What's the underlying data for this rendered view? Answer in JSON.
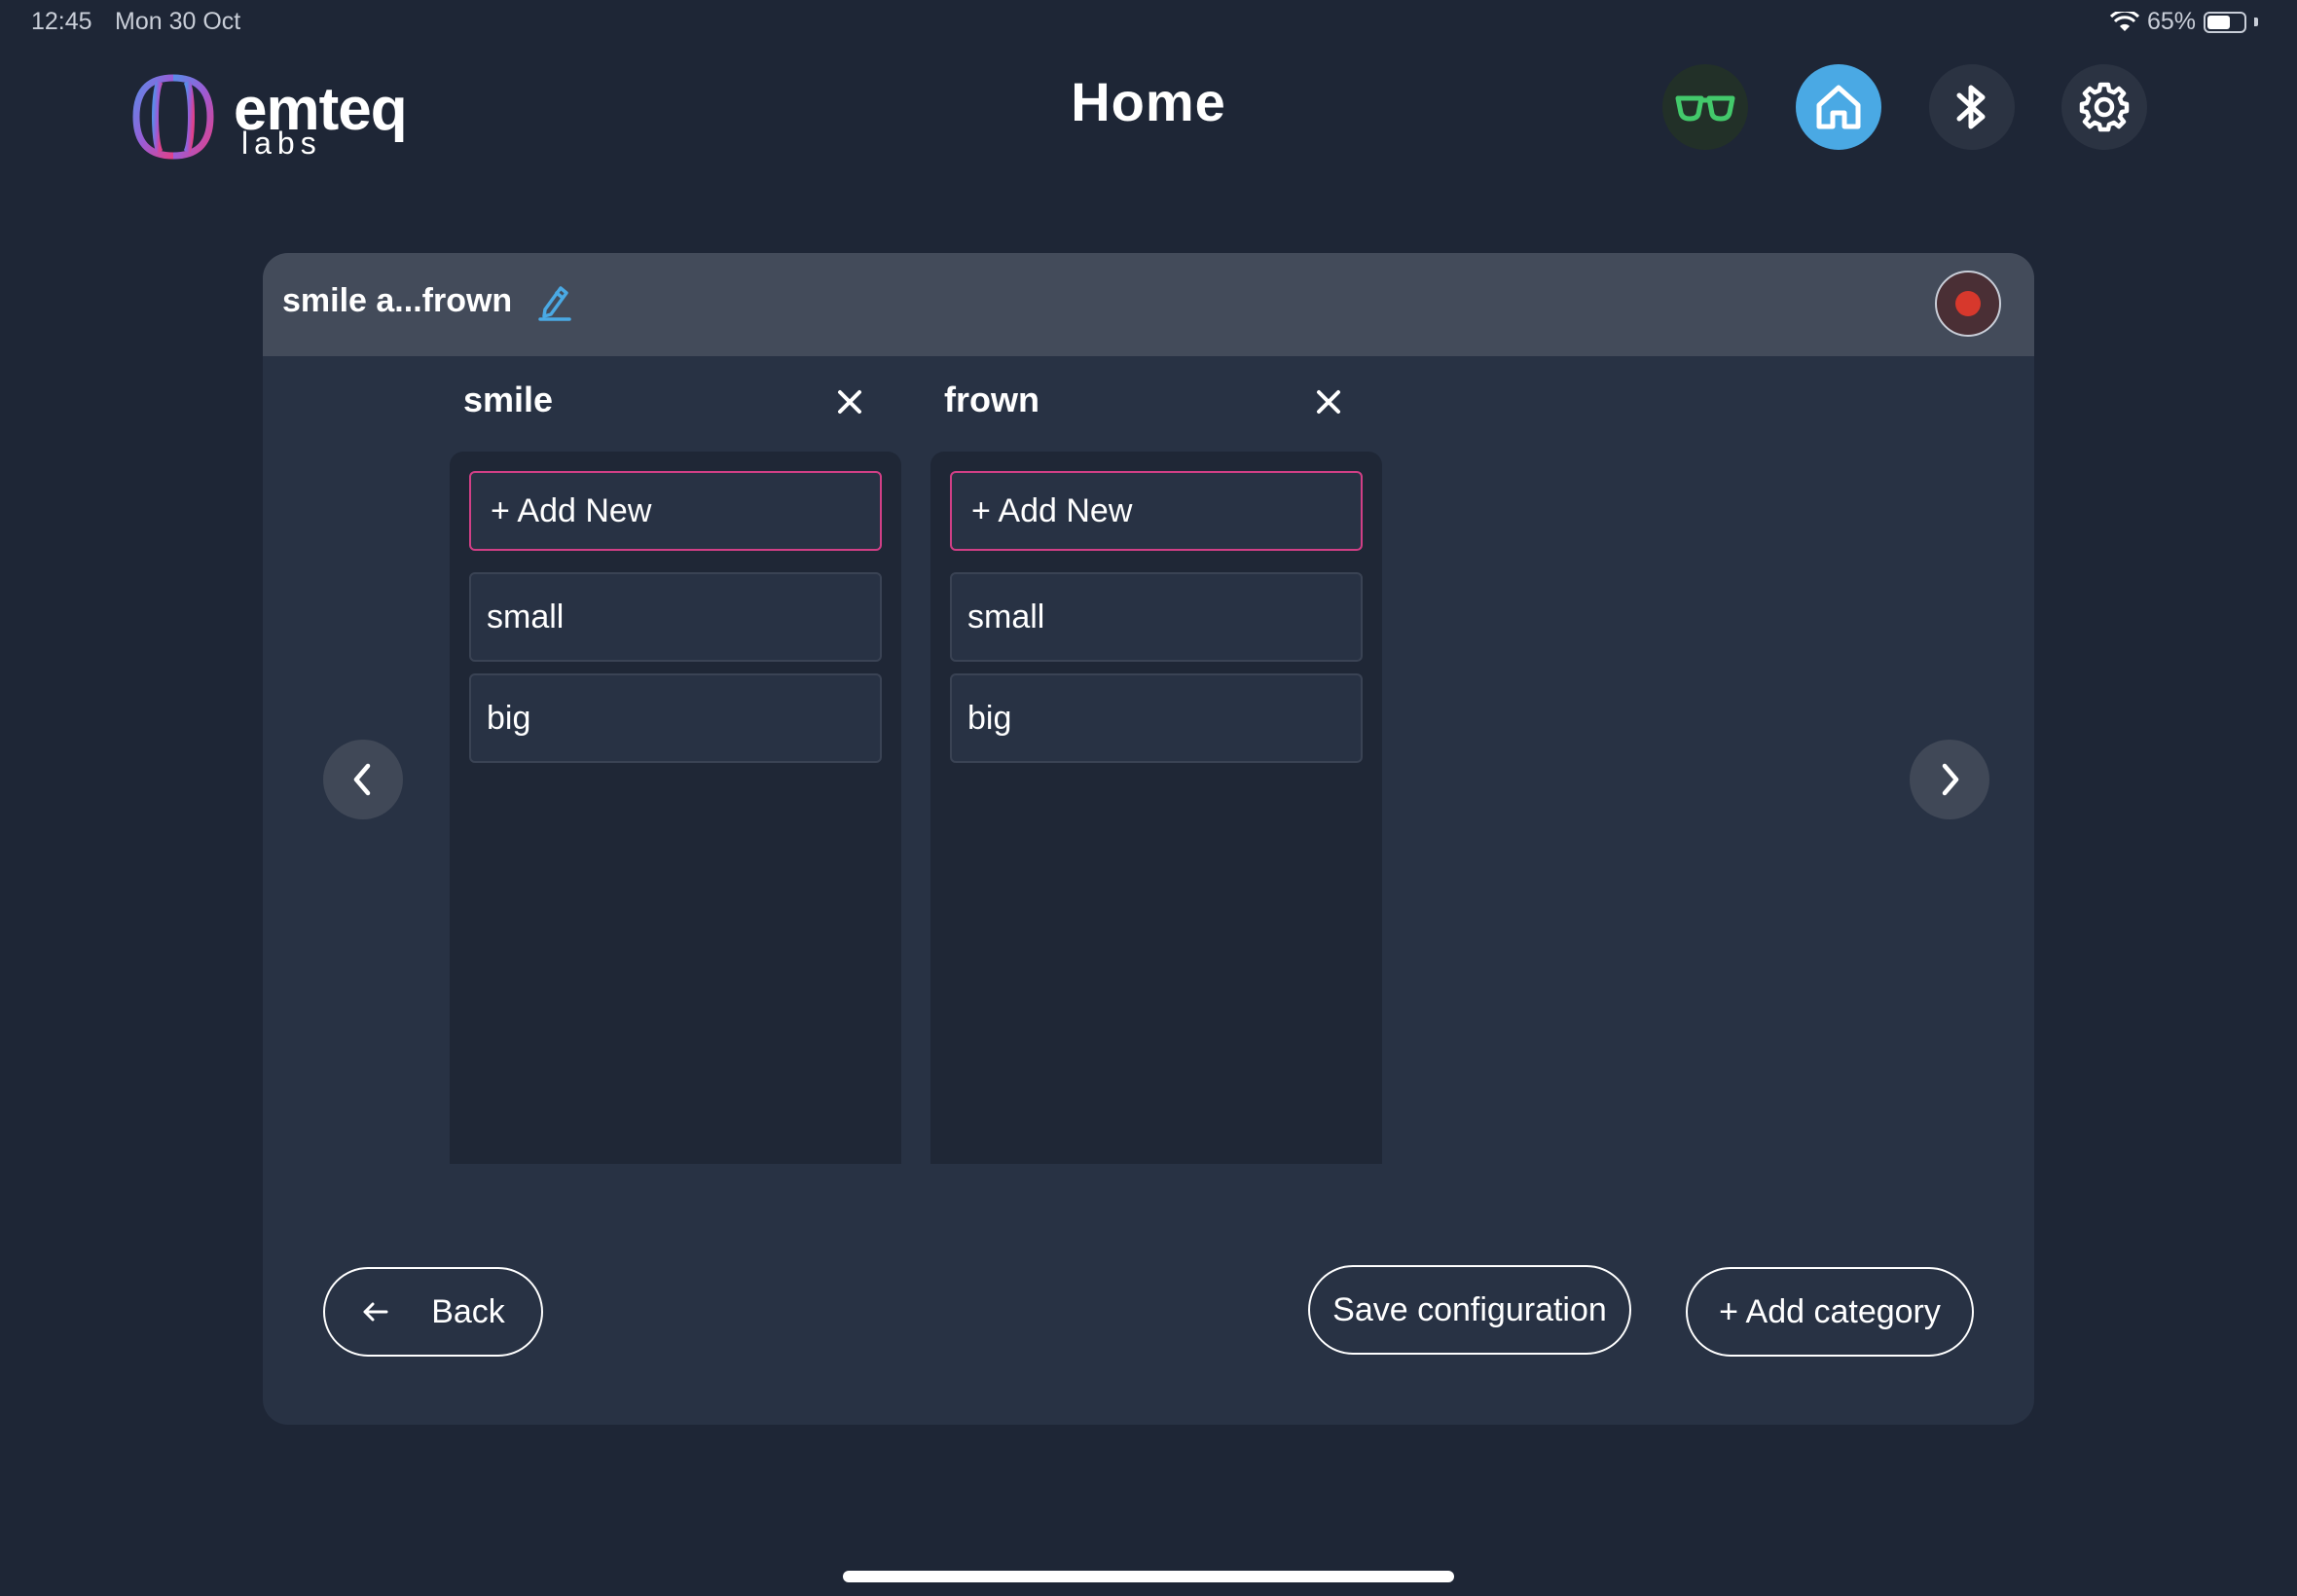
{
  "status_bar": {
    "time": "12:45",
    "date": "Mon 30 Oct",
    "battery": "65%",
    "battery_level": 0.65
  },
  "header": {
    "logo_main": "emteq",
    "logo_sub": "labs",
    "title": "Home"
  },
  "nav": [
    {
      "icon": "glasses-icon",
      "color": "#43c96b"
    },
    {
      "icon": "home-icon",
      "active": true
    },
    {
      "icon": "bluetooth-icon"
    },
    {
      "icon": "gear-icon"
    }
  ],
  "panel": {
    "config_name": "smile a...frown",
    "columns": [
      {
        "title": "smile",
        "add_label": "+ Add New",
        "items": [
          "small",
          "big"
        ]
      },
      {
        "title": "frown",
        "add_label": "+ Add New",
        "items": [
          "small",
          "big"
        ]
      }
    ],
    "back_label": "Back",
    "save_label": "Save configuration",
    "add_category_label": "+ Add category"
  },
  "colors": {
    "background": "#1e2636",
    "panel": "#283244",
    "accent_blue": "#4aa9e4",
    "accent_pink": "#d13f86",
    "record_red": "#d7382c"
  }
}
